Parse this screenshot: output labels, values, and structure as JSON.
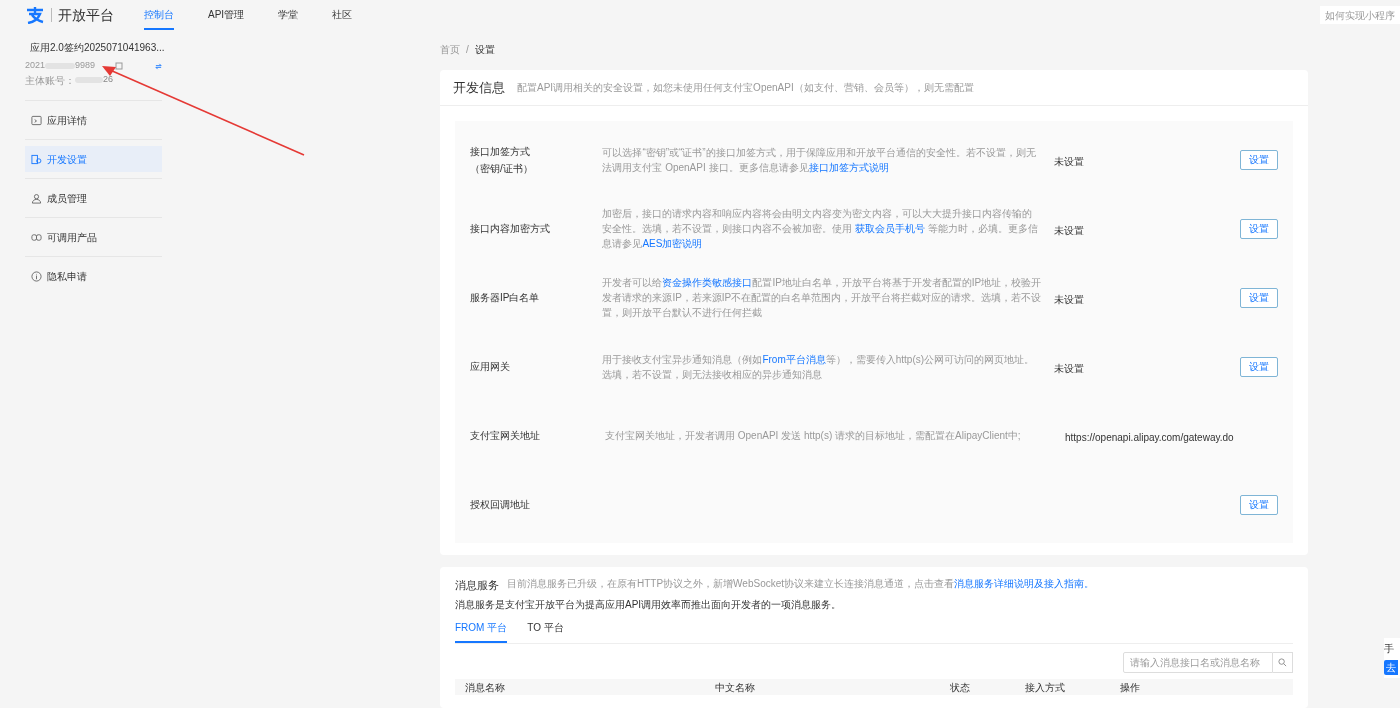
{
  "header": {
    "brand": "开放平台",
    "nav": [
      {
        "label": "控制台",
        "selected": true
      },
      {
        "label": "API管理",
        "selected": false
      },
      {
        "label": "学堂",
        "selected": false
      },
      {
        "label": "社区",
        "selected": false
      }
    ],
    "help_search": "如何实现小程序"
  },
  "app": {
    "name": "应用2.0签约2025071041963...",
    "id_prefix": "2021",
    "id_suffix": "9989",
    "account_label": "主体账号：",
    "account_suffix": "26"
  },
  "sidebar": {
    "items": [
      {
        "label": "应用详情",
        "kind": "doc",
        "selected": false
      },
      {
        "label": "开发设置",
        "kind": "dev",
        "selected": true
      },
      {
        "label": "成员管理",
        "kind": "user",
        "selected": false
      },
      {
        "label": "可调用产品",
        "kind": "box",
        "selected": false
      },
      {
        "label": "隐私申请",
        "kind": "shield",
        "selected": false
      }
    ]
  },
  "breadcrumb": [
    "首页",
    "/",
    "设置"
  ],
  "dev_info": {
    "title": "开发信息",
    "subtitle": "配置API调用相关的安全设置，如您未使用任何支付宝OpenAPI（如支付、营销、会员等），则无需配置",
    "rows": [
      {
        "label": "接口加签方式",
        "label_2": "（密钥/证书）",
        "description": [
          {
            "kind": "plain",
            "text": "可以选择“密钥”或“证书”的接口加签方式，用于保障应用和开放平台通信的安全性。若不设置，则无法调用支付宝 OpenAPI 接口。更多信息请参见"
          },
          {
            "kind": "link",
            "text": "接口加签方式说明"
          }
        ],
        "status": "未设置",
        "button": "设置"
      },
      {
        "label": "接口内容加密方式",
        "description": [
          {
            "kind": "plain",
            "text": "加密后，接口的请求内容和响应内容将会由明文内容变为密文内容，可以大大提升接口内容传输的安全性。选填，若不设置，则接口内容不会被加密。使用 "
          },
          {
            "kind": "link",
            "text": "获取会员手机号"
          },
          {
            "kind": "plain",
            "text": " 等能力时，必填。更多信息请参见"
          },
          {
            "kind": "link",
            "text": "AES加密说明"
          }
        ],
        "status": "未设置",
        "button": "设置"
      },
      {
        "label": "服务器IP白名单",
        "description": [
          {
            "kind": "plain",
            "text": "开发者可以给"
          },
          {
            "kind": "link",
            "text": "资金操作类敏感接口"
          },
          {
            "kind": "plain",
            "text": "配置IP地址白名单，开放平台将基于开发者配置的IP地址，校验开发者请求的来源IP，若来源IP不在配置的白名单范围内，开放平台将拦截对应的请求。选填，若不设置，则开放平台默认不进行任何拦截"
          }
        ],
        "status": "未设置",
        "button": "设置"
      },
      {
        "label": "应用网关",
        "description": [
          {
            "kind": "plain",
            "text": "用于接收支付宝异步通知消息（例如"
          },
          {
            "kind": "link",
            "text": "From平台消息"
          },
          {
            "kind": "plain",
            "text": "等），需要传入http(s)公网可访问的网页地址。选填，若不设置，则无法接收相应的异步通知消息"
          }
        ],
        "status": "未设置",
        "button": "设置"
      },
      {
        "label": "支付宝网关地址",
        "description": [
          {
            "kind": "plain",
            "text": "支付宝网关地址，开发者调用 OpenAPI 发送 http(s) 请求的目标地址，需配置在AlipayClient中;"
          }
        ],
        "status": "https://openapi.alipay.com/gateway.do"
      },
      {
        "label": "授权回调地址",
        "button": "设置"
      }
    ]
  },
  "message_service": {
    "title": "消息服务",
    "notice": [
      {
        "kind": "plain",
        "text": "目前消息服务已升级，在原有HTTP协议之外，新增WebSocket协议来建立长连接消息通道，点击查看"
      },
      {
        "kind": "link",
        "text": "消息服务详细说明及接入指南。"
      }
    ],
    "description": "消息服务是支付宝开放平台为提高应用API调用效率而推出面向开发者的一项消息服务。",
    "tabs": [
      {
        "label": "FROM 平台",
        "selected": true
      },
      {
        "label": "TO 平台",
        "selected": false
      }
    ],
    "search": {
      "placeholder": "请输入消息接口名或消息名称"
    },
    "table": {
      "columns": [
        "消息名称",
        "中文名称",
        "状态",
        "接入方式",
        "操作"
      ]
    }
  },
  "floating": {
    "label": "手",
    "button": "去"
  }
}
